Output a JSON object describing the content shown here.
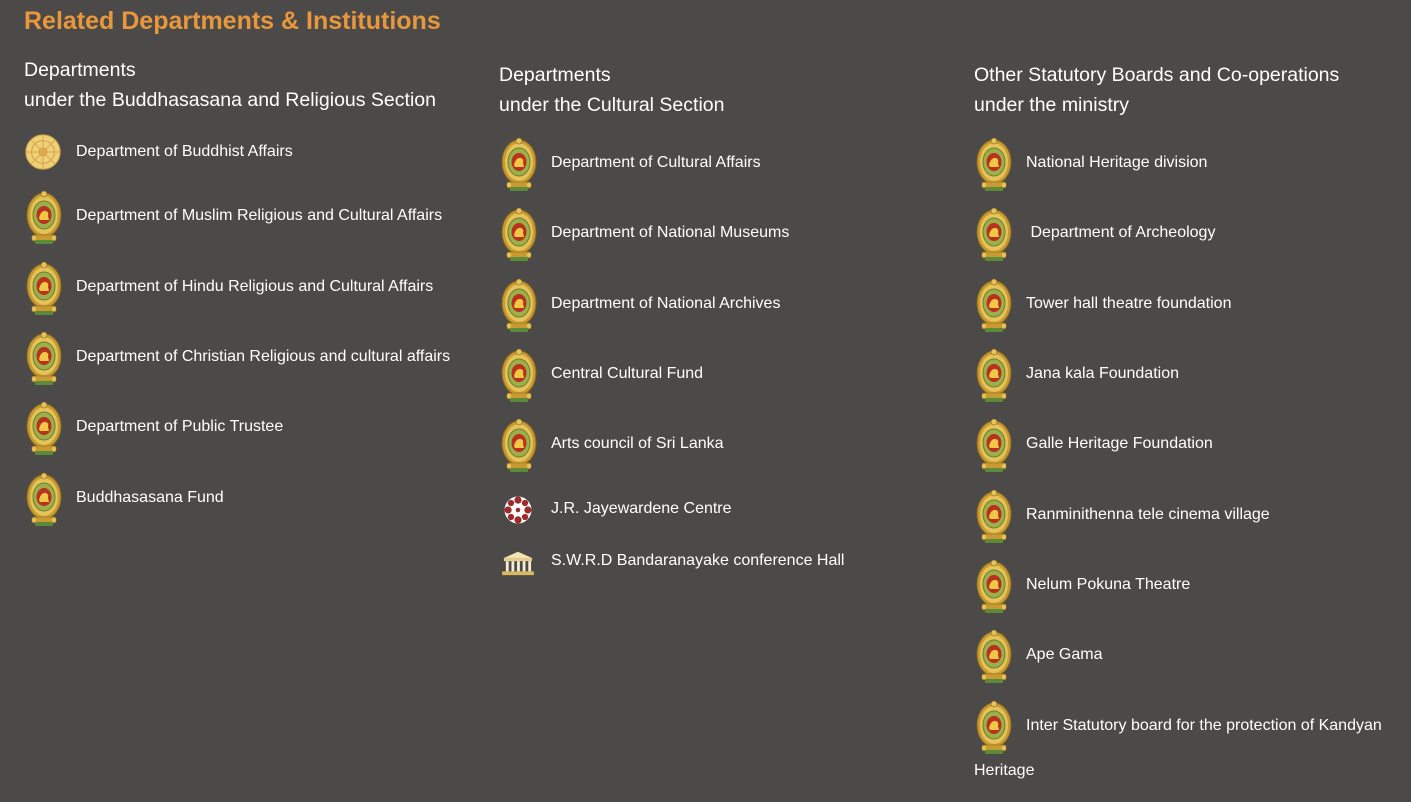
{
  "title": "Related Departments & Institutions",
  "columns": [
    {
      "heading_line1": "Departments",
      "heading_line2": "under the Buddhasasana and Religious Section",
      "items": [
        {
          "label": "Department of Buddhist Affairs",
          "icon": "dharma-wheel-icon"
        },
        {
          "label": "Department of Muslim Religious and Cultural Affairs",
          "icon": "sri-lanka-emblem-icon"
        },
        {
          "label": "Department of Hindu Religious and Cultural Affairs",
          "icon": "sri-lanka-emblem-icon"
        },
        {
          "label": "Department of Christian Religious and cultural affairs",
          "icon": "sri-lanka-emblem-icon"
        },
        {
          "label": "Department of Public Trustee",
          "icon": "sri-lanka-emblem-icon"
        },
        {
          "label": "Buddhasasana Fund",
          "icon": "sri-lanka-emblem-icon"
        }
      ]
    },
    {
      "heading_line1": "Departments",
      "heading_line2": "under the Cultural Section",
      "items": [
        {
          "label": "Department of Cultural Affairs",
          "icon": "sri-lanka-emblem-icon"
        },
        {
          "label": "Department of National Museums",
          "icon": "sri-lanka-emblem-icon"
        },
        {
          "label": "Department of National Archives",
          "icon": "sri-lanka-emblem-icon"
        },
        {
          "label": "Central Cultural Fund",
          "icon": "sri-lanka-emblem-icon"
        },
        {
          "label": "Arts council of Sri Lanka",
          "icon": "sri-lanka-emblem-icon"
        },
        {
          "label": "J.R. Jayewardene Centre",
          "icon": "jr-centre-logo-icon"
        },
        {
          "label": "S.W.R.D Bandaranayake conference Hall",
          "icon": "conference-hall-logo-icon"
        }
      ]
    },
    {
      "heading_line1": "Other Statutory Boards and Co-operations",
      "heading_line2": "under the ministry",
      "items": [
        {
          "label": "National Heritage division",
          "icon": "sri-lanka-emblem-icon"
        },
        {
          "label": " Department of Archeology",
          "icon": "sri-lanka-emblem-icon"
        },
        {
          "label": "Tower hall theatre foundation",
          "icon": "sri-lanka-emblem-icon"
        },
        {
          "label": "Jana kala Foundation",
          "icon": "sri-lanka-emblem-icon"
        },
        {
          "label": "Galle Heritage Foundation",
          "icon": "sri-lanka-emblem-icon"
        },
        {
          "label": "Ranminithenna tele cinema village",
          "icon": "sri-lanka-emblem-icon"
        },
        {
          "label": "Nelum Pokuna Theatre",
          "icon": "sri-lanka-emblem-icon"
        },
        {
          "label": "Ape Gama",
          "icon": "sri-lanka-emblem-icon"
        },
        {
          "label": "Inter Statutory board for the protection of Kandyan",
          "label_cont": "Heritage",
          "icon": "sri-lanka-emblem-icon"
        }
      ]
    }
  ],
  "colors": {
    "background": "#4b4a48",
    "title": "#e8973c",
    "text": "#ffffff",
    "emblem_gold": "#d9a93b",
    "emblem_red": "#b8321f"
  }
}
